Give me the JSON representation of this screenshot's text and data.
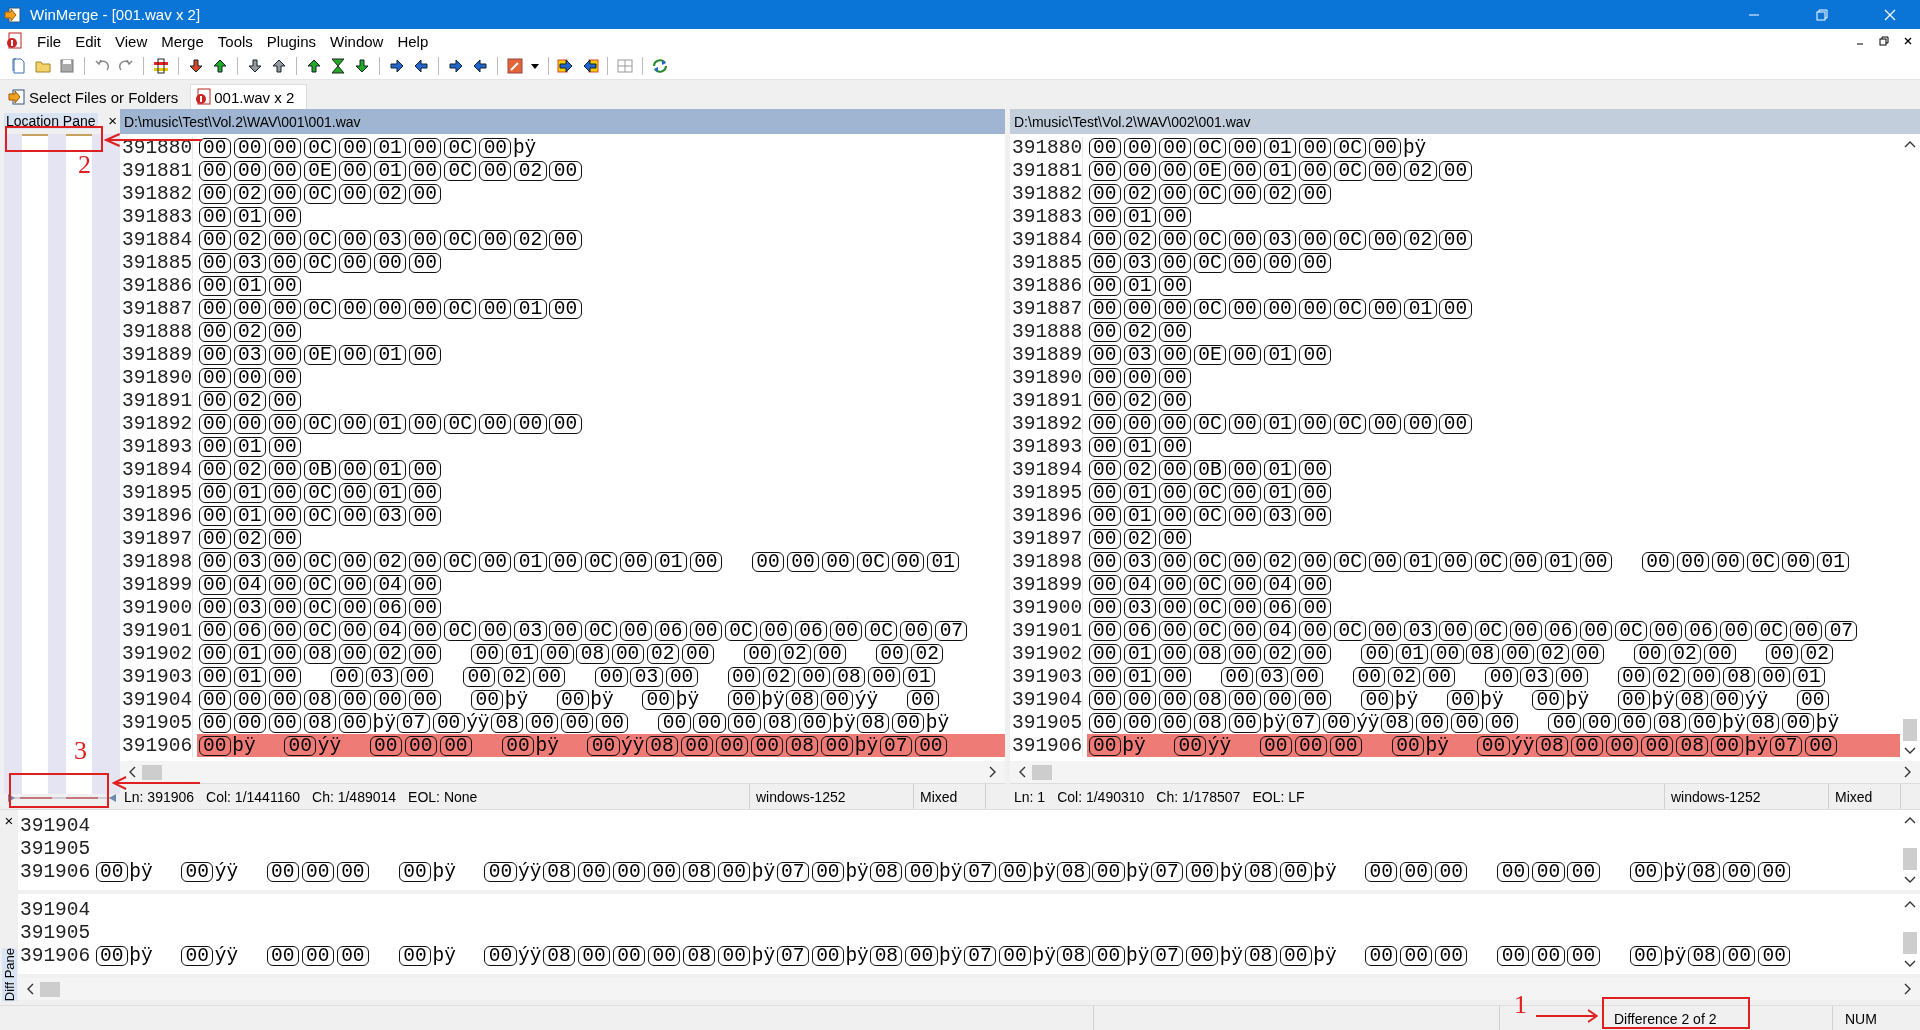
{
  "window": {
    "title": "WinMerge - [001.wav x 2]"
  },
  "menu": [
    "File",
    "Edit",
    "View",
    "Merge",
    "Tools",
    "Plugins",
    "Window",
    "Help"
  ],
  "tabs": [
    {
      "label": "Select Files or Folders",
      "selected": false
    },
    {
      "label": "001.wav x 2",
      "selected": true
    }
  ],
  "location_pane": {
    "title": "Location Pane",
    "close": "×"
  },
  "panes": [
    {
      "path": "D:\\music\\Test\\Vol.2\\WAV\\001\\001.wav",
      "active": true,
      "status": {
        "fields": [
          "Ln: 391906",
          "Col: 1/1441160",
          "Ch: 1/489014",
          "EOL: None"
        ],
        "encoding": "windows-1252",
        "eol_mode": "Mixed"
      },
      "lines": [
        {
          "number": "391880",
          "diff": false,
          "runs": [
            [
              {
                "hex": [
                  "00",
                  "00",
                  "00",
                  "0C",
                  "00",
                  "01",
                  "00",
                  "0C",
                  "00"
                ]
              },
              {
                "chars": "þÿ"
              }
            ]
          ]
        },
        {
          "number": "391881",
          "diff": false,
          "runs": [
            [
              {
                "hex": [
                  "00",
                  "00",
                  "00",
                  "0E",
                  "00",
                  "01",
                  "00",
                  "0C",
                  "00",
                  "02",
                  "00"
                ]
              }
            ]
          ]
        },
        {
          "number": "391882",
          "diff": false,
          "runs": [
            [
              {
                "hex": [
                  "00",
                  "02",
                  "00",
                  "0C",
                  "00",
                  "02",
                  "00"
                ]
              }
            ]
          ]
        },
        {
          "number": "391883",
          "diff": false,
          "runs": [
            [
              {
                "hex": [
                  "00",
                  "01",
                  "00"
                ]
              }
            ]
          ]
        },
        {
          "number": "391884",
          "diff": false,
          "runs": [
            [
              {
                "hex": [
                  "00",
                  "02",
                  "00",
                  "0C",
                  "00",
                  "03",
                  "00",
                  "0C",
                  "00",
                  "02",
                  "00"
                ]
              }
            ]
          ]
        },
        {
          "number": "391885",
          "diff": false,
          "runs": [
            [
              {
                "hex": [
                  "00",
                  "03",
                  "00",
                  "0C",
                  "00",
                  "00",
                  "00"
                ]
              }
            ]
          ]
        },
        {
          "number": "391886",
          "diff": false,
          "runs": [
            [
              {
                "hex": [
                  "00",
                  "01",
                  "00"
                ]
              }
            ]
          ]
        },
        {
          "number": "391887",
          "diff": false,
          "runs": [
            [
              {
                "hex": [
                  "00",
                  "00",
                  "00",
                  "0C",
                  "00",
                  "00",
                  "00",
                  "0C",
                  "00",
                  "01",
                  "00"
                ]
              }
            ]
          ]
        },
        {
          "number": "391888",
          "diff": false,
          "runs": [
            [
              {
                "hex": [
                  "00",
                  "02",
                  "00"
                ]
              }
            ]
          ]
        },
        {
          "number": "391889",
          "diff": false,
          "runs": [
            [
              {
                "hex": [
                  "00",
                  "03",
                  "00",
                  "0E",
                  "00",
                  "01",
                  "00"
                ]
              }
            ]
          ]
        },
        {
          "number": "391890",
          "diff": false,
          "runs": [
            [
              {
                "hex": [
                  "00",
                  "00",
                  "00"
                ]
              }
            ]
          ]
        },
        {
          "number": "391891",
          "diff": false,
          "runs": [
            [
              {
                "hex": [
                  "00",
                  "02",
                  "00"
                ]
              }
            ]
          ]
        },
        {
          "number": "391892",
          "diff": false,
          "runs": [
            [
              {
                "hex": [
                  "00",
                  "00",
                  "00",
                  "0C",
                  "00",
                  "01",
                  "00",
                  "0C",
                  "00",
                  "00",
                  "00"
                ]
              }
            ]
          ]
        },
        {
          "number": "391893",
          "diff": false,
          "runs": [
            [
              {
                "hex": [
                  "00",
                  "01",
                  "00"
                ]
              }
            ]
          ]
        },
        {
          "number": "391894",
          "diff": false,
          "runs": [
            [
              {
                "hex": [
                  "00",
                  "02",
                  "00",
                  "0B",
                  "00",
                  "01",
                  "00"
                ]
              }
            ]
          ]
        },
        {
          "number": "391895",
          "diff": false,
          "runs": [
            [
              {
                "hex": [
                  "00",
                  "01",
                  "00",
                  "0C",
                  "00",
                  "01",
                  "00"
                ]
              }
            ]
          ]
        },
        {
          "number": "391896",
          "diff": false,
          "runs": [
            [
              {
                "hex": [
                  "00",
                  "01",
                  "00",
                  "0C",
                  "00",
                  "03",
                  "00"
                ]
              }
            ]
          ]
        },
        {
          "number": "391897",
          "diff": false,
          "runs": [
            [
              {
                "hex": [
                  "00",
                  "02",
                  "00"
                ]
              }
            ]
          ]
        },
        {
          "number": "391898",
          "diff": false,
          "runs": [
            [
              {
                "hex": [
                  "00",
                  "03",
                  "00",
                  "0C",
                  "00",
                  "02",
                  "00",
                  "0C",
                  "00",
                  "01",
                  "00",
                  "0C",
                  "00",
                  "01",
                  "00"
                ]
              }
            ],
            [
              {
                "hex": [
                  "00",
                  "00",
                  "00",
                  "0C",
                  "00",
                  "01"
                ]
              }
            ]
          ]
        },
        {
          "number": "391899",
          "diff": false,
          "runs": [
            [
              {
                "hex": [
                  "00",
                  "04",
                  "00",
                  "0C",
                  "00",
                  "04",
                  "00"
                ]
              }
            ]
          ]
        },
        {
          "number": "391900",
          "diff": false,
          "runs": [
            [
              {
                "hex": [
                  "00",
                  "03",
                  "00",
                  "0C",
                  "00",
                  "06",
                  "00"
                ]
              }
            ]
          ]
        },
        {
          "number": "391901",
          "diff": false,
          "runs": [
            [
              {
                "hex": [
                  "00",
                  "06",
                  "00",
                  "0C",
                  "00",
                  "04",
                  "00",
                  "0C",
                  "00",
                  "03",
                  "00",
                  "0C",
                  "00",
                  "06",
                  "00",
                  "0C",
                  "00",
                  "06",
                  "00",
                  "0C",
                  "00",
                  "07"
                ]
              }
            ]
          ]
        },
        {
          "number": "391902",
          "diff": false,
          "runs": [
            [
              {
                "hex": [
                  "00",
                  "01",
                  "00",
                  "08",
                  "00",
                  "02",
                  "00"
                ]
              }
            ],
            [
              {
                "hex": [
                  "00",
                  "01",
                  "00",
                  "08",
                  "00",
                  "02",
                  "00"
                ]
              }
            ],
            [
              {
                "hex": [
                  "00",
                  "02",
                  "00"
                ]
              }
            ],
            [
              {
                "hex": [
                  "00",
                  "02"
                ]
              }
            ]
          ]
        },
        {
          "number": "391903",
          "diff": false,
          "runs": [
            [
              {
                "hex": [
                  "00",
                  "01",
                  "00"
                ]
              }
            ],
            [
              {
                "hex": [
                  "00",
                  "03",
                  "00"
                ]
              }
            ],
            [
              {
                "hex": [
                  "00",
                  "02",
                  "00"
                ]
              }
            ],
            [
              {
                "hex": [
                  "00",
                  "03",
                  "00"
                ]
              }
            ],
            [
              {
                "hex": [
                  "00",
                  "02",
                  "00",
                  "08",
                  "00",
                  "01"
                ]
              }
            ]
          ]
        },
        {
          "number": "391904",
          "diff": false,
          "runs": [
            [
              {
                "hex": [
                  "00",
                  "00",
                  "00",
                  "08",
                  "00",
                  "00",
                  "00"
                ]
              }
            ],
            [
              {
                "hex": [
                  "00"
                ]
              },
              {
                "chars": "þÿ"
              }
            ],
            [
              {
                "hex": [
                  "00"
                ]
              },
              {
                "chars": "þÿ"
              }
            ],
            [
              {
                "hex": [
                  "00"
                ]
              },
              {
                "chars": "þÿ"
              }
            ],
            [
              {
                "hex": [
                  "00"
                ]
              },
              {
                "chars": "þÿ"
              },
              {
                "hex": [
                  "08",
                  "00"
                ]
              },
              {
                "chars": "ýÿ"
              }
            ],
            [
              {
                "hex": [
                  "00"
                ]
              }
            ]
          ]
        },
        {
          "number": "391905",
          "diff": false,
          "runs": [
            [
              {
                "hex": [
                  "00",
                  "00",
                  "00",
                  "08",
                  "00"
                ]
              },
              {
                "chars": "þÿ"
              },
              {
                "hex": [
                  "07",
                  "00"
                ]
              },
              {
                "chars": "ýÿ"
              },
              {
                "hex": [
                  "08",
                  "00",
                  "00",
                  "00"
                ]
              }
            ],
            [
              {
                "hex": [
                  "00",
                  "00",
                  "00",
                  "08",
                  "00"
                ]
              },
              {
                "chars": "þÿ"
              },
              {
                "hex": [
                  "08",
                  "00"
                ]
              },
              {
                "chars": "þÿ"
              }
            ]
          ]
        },
        {
          "number": "391906",
          "diff": true,
          "runs": [
            [
              {
                "hex": [
                  "00"
                ]
              },
              {
                "chars": "þÿ"
              }
            ],
            [
              {
                "hex": [
                  "00"
                ]
              },
              {
                "chars": "ýÿ"
              }
            ],
            [
              {
                "hex": [
                  "00",
                  "00",
                  "00"
                ]
              }
            ],
            [
              {
                "hex": [
                  "00"
                ]
              },
              {
                "chars": "þÿ"
              }
            ],
            [
              {
                "hex": [
                  "00"
                ]
              },
              {
                "chars": "ýÿ"
              },
              {
                "hex": [
                  "08",
                  "00",
                  "00",
                  "00",
                  "08",
                  "00"
                ]
              },
              {
                "chars": "þÿ"
              },
              {
                "hex": [
                  "07",
                  "00"
                ]
              }
            ]
          ]
        }
      ]
    },
    {
      "path": "D:\\music\\Test\\Vol.2\\WAV\\002\\001.wav",
      "active": false,
      "status": {
        "fields": [
          "Ln: 1",
          "Col: 1/490310",
          "Ch: 1/178507",
          "EOL: LF"
        ],
        "encoding": "windows-1252",
        "eol_mode": "Mixed"
      },
      "lines": [
        {
          "number": "391880",
          "diff": false,
          "runs": [
            [
              {
                "hex": [
                  "00",
                  "00",
                  "00",
                  "0C",
                  "00",
                  "01",
                  "00",
                  "0C",
                  "00"
                ]
              },
              {
                "chars": "þÿ"
              }
            ]
          ]
        },
        {
          "number": "391881",
          "diff": false,
          "runs": [
            [
              {
                "hex": [
                  "00",
                  "00",
                  "00",
                  "0E",
                  "00",
                  "01",
                  "00",
                  "0C",
                  "00",
                  "02",
                  "00"
                ]
              }
            ]
          ]
        },
        {
          "number": "391882",
          "diff": false,
          "runs": [
            [
              {
                "hex": [
                  "00",
                  "02",
                  "00",
                  "0C",
                  "00",
                  "02",
                  "00"
                ]
              }
            ]
          ]
        },
        {
          "number": "391883",
          "diff": false,
          "runs": [
            [
              {
                "hex": [
                  "00",
                  "01",
                  "00"
                ]
              }
            ]
          ]
        },
        {
          "number": "391884",
          "diff": false,
          "runs": [
            [
              {
                "hex": [
                  "00",
                  "02",
                  "00",
                  "0C",
                  "00",
                  "03",
                  "00",
                  "0C",
                  "00",
                  "02",
                  "00"
                ]
              }
            ]
          ]
        },
        {
          "number": "391885",
          "diff": false,
          "runs": [
            [
              {
                "hex": [
                  "00",
                  "03",
                  "00",
                  "0C",
                  "00",
                  "00",
                  "00"
                ]
              }
            ]
          ]
        },
        {
          "number": "391886",
          "diff": false,
          "runs": [
            [
              {
                "hex": [
                  "00",
                  "01",
                  "00"
                ]
              }
            ]
          ]
        },
        {
          "number": "391887",
          "diff": false,
          "runs": [
            [
              {
                "hex": [
                  "00",
                  "00",
                  "00",
                  "0C",
                  "00",
                  "00",
                  "00",
                  "0C",
                  "00",
                  "01",
                  "00"
                ]
              }
            ]
          ]
        },
        {
          "number": "391888",
          "diff": false,
          "runs": [
            [
              {
                "hex": [
                  "00",
                  "02",
                  "00"
                ]
              }
            ]
          ]
        },
        {
          "number": "391889",
          "diff": false,
          "runs": [
            [
              {
                "hex": [
                  "00",
                  "03",
                  "00",
                  "0E",
                  "00",
                  "01",
                  "00"
                ]
              }
            ]
          ]
        },
        {
          "number": "391890",
          "diff": false,
          "runs": [
            [
              {
                "hex": [
                  "00",
                  "00",
                  "00"
                ]
              }
            ]
          ]
        },
        {
          "number": "391891",
          "diff": false,
          "runs": [
            [
              {
                "hex": [
                  "00",
                  "02",
                  "00"
                ]
              }
            ]
          ]
        },
        {
          "number": "391892",
          "diff": false,
          "runs": [
            [
              {
                "hex": [
                  "00",
                  "00",
                  "00",
                  "0C",
                  "00",
                  "01",
                  "00",
                  "0C",
                  "00",
                  "00",
                  "00"
                ]
              }
            ]
          ]
        },
        {
          "number": "391893",
          "diff": false,
          "runs": [
            [
              {
                "hex": [
                  "00",
                  "01",
                  "00"
                ]
              }
            ]
          ]
        },
        {
          "number": "391894",
          "diff": false,
          "runs": [
            [
              {
                "hex": [
                  "00",
                  "02",
                  "00",
                  "0B",
                  "00",
                  "01",
                  "00"
                ]
              }
            ]
          ]
        },
        {
          "number": "391895",
          "diff": false,
          "runs": [
            [
              {
                "hex": [
                  "00",
                  "01",
                  "00",
                  "0C",
                  "00",
                  "01",
                  "00"
                ]
              }
            ]
          ]
        },
        {
          "number": "391896",
          "diff": false,
          "runs": [
            [
              {
                "hex": [
                  "00",
                  "01",
                  "00",
                  "0C",
                  "00",
                  "03",
                  "00"
                ]
              }
            ]
          ]
        },
        {
          "number": "391897",
          "diff": false,
          "runs": [
            [
              {
                "hex": [
                  "00",
                  "02",
                  "00"
                ]
              }
            ]
          ]
        },
        {
          "number": "391898",
          "diff": false,
          "runs": [
            [
              {
                "hex": [
                  "00",
                  "03",
                  "00",
                  "0C",
                  "00",
                  "02",
                  "00",
                  "0C",
                  "00",
                  "01",
                  "00",
                  "0C",
                  "00",
                  "01",
                  "00"
                ]
              }
            ],
            [
              {
                "hex": [
                  "00",
                  "00",
                  "00",
                  "0C",
                  "00",
                  "01"
                ]
              }
            ]
          ]
        },
        {
          "number": "391899",
          "diff": false,
          "runs": [
            [
              {
                "hex": [
                  "00",
                  "04",
                  "00",
                  "0C",
                  "00",
                  "04",
                  "00"
                ]
              }
            ]
          ]
        },
        {
          "number": "391900",
          "diff": false,
          "runs": [
            [
              {
                "hex": [
                  "00",
                  "03",
                  "00",
                  "0C",
                  "00",
                  "06",
                  "00"
                ]
              }
            ]
          ]
        },
        {
          "number": "391901",
          "diff": false,
          "runs": [
            [
              {
                "hex": [
                  "00",
                  "06",
                  "00",
                  "0C",
                  "00",
                  "04",
                  "00",
                  "0C",
                  "00",
                  "03",
                  "00",
                  "0C",
                  "00",
                  "06",
                  "00",
                  "0C",
                  "00",
                  "06",
                  "00",
                  "0C",
                  "00",
                  "07"
                ]
              }
            ]
          ]
        },
        {
          "number": "391902",
          "diff": false,
          "runs": [
            [
              {
                "hex": [
                  "00",
                  "01",
                  "00",
                  "08",
                  "00",
                  "02",
                  "00"
                ]
              }
            ],
            [
              {
                "hex": [
                  "00",
                  "01",
                  "00",
                  "08",
                  "00",
                  "02",
                  "00"
                ]
              }
            ],
            [
              {
                "hex": [
                  "00",
                  "02",
                  "00"
                ]
              }
            ],
            [
              {
                "hex": [
                  "00",
                  "02"
                ]
              }
            ]
          ]
        },
        {
          "number": "391903",
          "diff": false,
          "runs": [
            [
              {
                "hex": [
                  "00",
                  "01",
                  "00"
                ]
              }
            ],
            [
              {
                "hex": [
                  "00",
                  "03",
                  "00"
                ]
              }
            ],
            [
              {
                "hex": [
                  "00",
                  "02",
                  "00"
                ]
              }
            ],
            [
              {
                "hex": [
                  "00",
                  "03",
                  "00"
                ]
              }
            ],
            [
              {
                "hex": [
                  "00",
                  "02",
                  "00",
                  "08",
                  "00",
                  "01"
                ]
              }
            ]
          ]
        },
        {
          "number": "391904",
          "diff": false,
          "runs": [
            [
              {
                "hex": [
                  "00",
                  "00",
                  "00",
                  "08",
                  "00",
                  "00",
                  "00"
                ]
              }
            ],
            [
              {
                "hex": [
                  "00"
                ]
              },
              {
                "chars": "þÿ"
              }
            ],
            [
              {
                "hex": [
                  "00"
                ]
              },
              {
                "chars": "þÿ"
              }
            ],
            [
              {
                "hex": [
                  "00"
                ]
              },
              {
                "chars": "þÿ"
              }
            ],
            [
              {
                "hex": [
                  "00"
                ]
              },
              {
                "chars": "þÿ"
              },
              {
                "hex": [
                  "08",
                  "00"
                ]
              },
              {
                "chars": "ýÿ"
              }
            ],
            [
              {
                "hex": [
                  "00"
                ]
              }
            ]
          ]
        },
        {
          "number": "391905",
          "diff": false,
          "runs": [
            [
              {
                "hex": [
                  "00",
                  "00",
                  "00",
                  "08",
                  "00"
                ]
              },
              {
                "chars": "þÿ"
              },
              {
                "hex": [
                  "07",
                  "00"
                ]
              },
              {
                "chars": "ýÿ"
              },
              {
                "hex": [
                  "08",
                  "00",
                  "00",
                  "00"
                ]
              }
            ],
            [
              {
                "hex": [
                  "00",
                  "00",
                  "00",
                  "08",
                  "00"
                ]
              },
              {
                "chars": "þÿ"
              },
              {
                "hex": [
                  "08",
                  "00"
                ]
              },
              {
                "chars": "þÿ"
              }
            ]
          ]
        },
        {
          "number": "391906",
          "diff": true,
          "runs": [
            [
              {
                "hex": [
                  "00"
                ]
              },
              {
                "chars": "þÿ"
              }
            ],
            [
              {
                "hex": [
                  "00"
                ]
              },
              {
                "chars": "ýÿ"
              }
            ],
            [
              {
                "hex": [
                  "00",
                  "00",
                  "00"
                ]
              }
            ],
            [
              {
                "hex": [
                  "00"
                ]
              },
              {
                "chars": "þÿ"
              }
            ],
            [
              {
                "hex": [
                  "00"
                ]
              },
              {
                "chars": "ýÿ"
              },
              {
                "hex": [
                  "08",
                  "00",
                  "00",
                  "00",
                  "08",
                  "00"
                ]
              },
              {
                "chars": "þÿ"
              },
              {
                "hex": [
                  "07",
                  "00"
                ]
              }
            ]
          ]
        }
      ]
    }
  ],
  "diff_pane": {
    "title": "Diff Pane",
    "close": "×",
    "panes": [
      {
        "lines": [
          {
            "number": "391904",
            "diff": false
          },
          {
            "number": "391905",
            "diff": false
          },
          {
            "number": "391906",
            "diff": false,
            "runs": [
              [
                {
                  "hex": [
                    "00"
                  ]
                },
                {
                  "chars": "þÿ"
                }
              ],
              [
                {
                  "hex": [
                    "00"
                  ]
                },
                {
                  "chars": "ýÿ"
                }
              ],
              [
                {
                  "hex": [
                    "00",
                    "00",
                    "00"
                  ]
                }
              ],
              [
                {
                  "hex": [
                    "00"
                  ]
                },
                {
                  "chars": "þÿ"
                }
              ],
              [
                {
                  "hex": [
                    "00"
                  ]
                },
                {
                  "chars": "ýÿ"
                },
                {
                  "hex": [
                    "08",
                    "00",
                    "00",
                    "00",
                    "08",
                    "00"
                  ]
                },
                {
                  "chars": "þÿ"
                },
                {
                  "hex": [
                    "07",
                    "00"
                  ]
                },
                {
                  "chars": "þÿ"
                },
                {
                  "hex": [
                    "08",
                    "00"
                  ]
                },
                {
                  "chars": "þÿ"
                },
                {
                  "hex": [
                    "07",
                    "00"
                  ]
                },
                {
                  "chars": "þÿ"
                },
                {
                  "hex": [
                    "08",
                    "00"
                  ]
                },
                {
                  "chars": "þÿ"
                },
                {
                  "hex": [
                    "07",
                    "00"
                  ]
                },
                {
                  "chars": "þÿ"
                },
                {
                  "hex": [
                    "08",
                    "00"
                  ]
                },
                {
                  "chars": "þÿ"
                }
              ],
              [
                {
                  "hex": [
                    "00",
                    "00",
                    "00"
                  ]
                }
              ],
              [
                {
                  "hex": [
                    "00",
                    "00",
                    "00"
                  ]
                }
              ],
              [
                {
                  "hex": [
                    "00"
                  ]
                },
                {
                  "chars": "þÿ"
                },
                {
                  "hex": [
                    "08",
                    "00",
                    "00"
                  ]
                }
              ]
            ]
          }
        ]
      },
      {
        "lines": [
          {
            "number": "391904",
            "diff": false
          },
          {
            "number": "391905",
            "diff": false
          },
          {
            "number": "391906",
            "diff": false,
            "runs": [
              [
                {
                  "hex": [
                    "00"
                  ]
                },
                {
                  "chars": "þÿ"
                }
              ],
              [
                {
                  "hex": [
                    "00"
                  ]
                },
                {
                  "chars": "ýÿ"
                }
              ],
              [
                {
                  "hex": [
                    "00",
                    "00",
                    "00"
                  ]
                }
              ],
              [
                {
                  "hex": [
                    "00"
                  ]
                },
                {
                  "chars": "þÿ"
                }
              ],
              [
                {
                  "hex": [
                    "00"
                  ]
                },
                {
                  "chars": "ýÿ"
                },
                {
                  "hex": [
                    "08",
                    "00",
                    "00",
                    "00",
                    "08",
                    "00"
                  ]
                },
                {
                  "chars": "þÿ"
                },
                {
                  "hex": [
                    "07",
                    "00"
                  ]
                },
                {
                  "chars": "þÿ"
                },
                {
                  "hex": [
                    "08",
                    "00"
                  ]
                },
                {
                  "chars": "þÿ"
                },
                {
                  "hex": [
                    "07",
                    "00"
                  ]
                },
                {
                  "chars": "þÿ"
                },
                {
                  "hex": [
                    "08",
                    "00"
                  ]
                },
                {
                  "chars": "þÿ"
                },
                {
                  "hex": [
                    "07",
                    "00"
                  ]
                },
                {
                  "chars": "þÿ"
                },
                {
                  "hex": [
                    "08",
                    "00"
                  ]
                },
                {
                  "chars": "þÿ"
                }
              ],
              [
                {
                  "hex": [
                    "00",
                    "00",
                    "00"
                  ]
                }
              ],
              [
                {
                  "hex": [
                    "00",
                    "00",
                    "00"
                  ]
                }
              ],
              [
                {
                  "hex": [
                    "00"
                  ]
                },
                {
                  "chars": "þÿ"
                },
                {
                  "hex": [
                    "08",
                    "00",
                    "00"
                  ]
                }
              ]
            ]
          }
        ]
      }
    ]
  },
  "status_bar": {
    "difference": "Difference 2 of 2",
    "num": "NUM"
  },
  "annotations": [
    {
      "number": "1"
    },
    {
      "number": "2"
    },
    {
      "number": "3"
    }
  ]
}
